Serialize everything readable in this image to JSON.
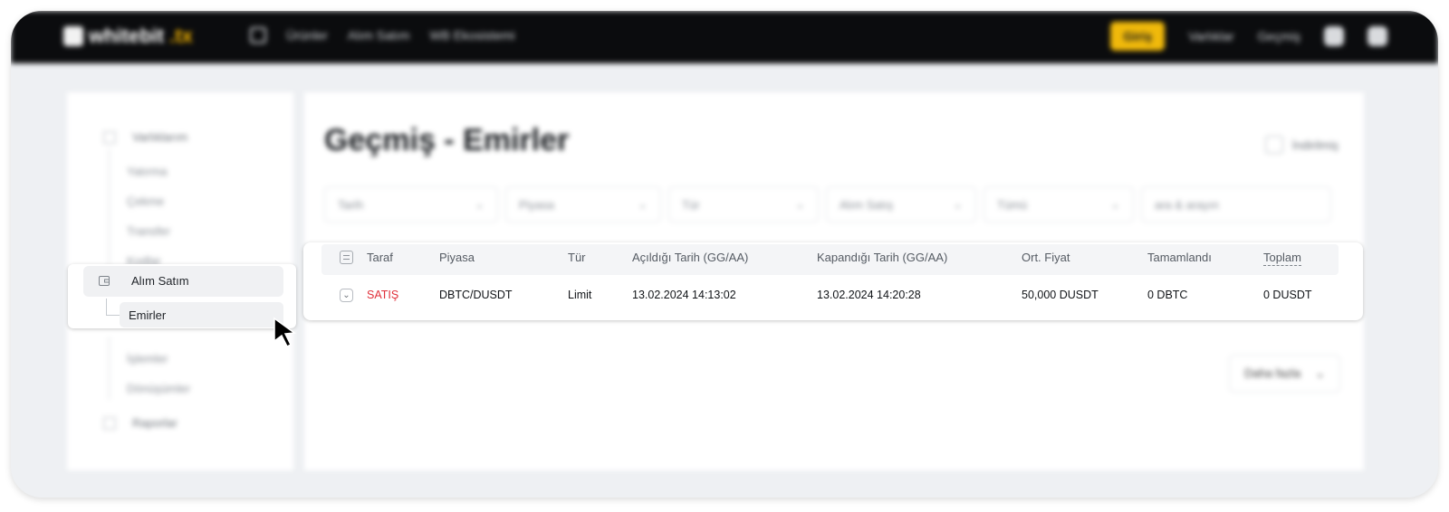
{
  "topbar": {
    "logo_text_a": "whitebit",
    "logo_text_b": ".tx",
    "nav": [
      "Ürünler",
      "Alım Satım",
      "WB Ekosistemi"
    ],
    "cta": "Giriş",
    "links": [
      "Varlıklar",
      "Geçmiş"
    ]
  },
  "sidebar": {
    "group1_label": "Varlıklarım",
    "group1_items": [
      "Yatırma",
      "Çekme",
      "Transfer",
      "Kodlar"
    ],
    "trade_label": "Alım Satım",
    "trade_items": [
      "Emirler",
      "İşlemler",
      "Dönüşümler"
    ],
    "group3_label": "Raporlar"
  },
  "main": {
    "title": "Geçmiş - Emirler",
    "download_label": "İndirilmiş",
    "filters": [
      {
        "label": "Tarih"
      },
      {
        "label": "Piyasa"
      },
      {
        "label": "Tür"
      },
      {
        "label": "Alım Satış"
      },
      {
        "label": "Tümü"
      },
      {
        "label": "ara & arayın"
      }
    ],
    "pager_label": "Daha fazla"
  },
  "table": {
    "headers": [
      "Taraf",
      "Piyasa",
      "Tür",
      "Açıldığı Tarih (GG/AA)",
      "Kapandığı Tarih (GG/AA)",
      "Ort. Fiyat",
      "Tamamlandı",
      "Toplam"
    ],
    "rows": [
      {
        "side": "SATIŞ",
        "market": "DBTC/DUSDT",
        "type": "Limit",
        "opened": "13.02.2024 14:13:02",
        "closed": "13.02.2024 14:20:28",
        "avg_price": "50,000 DUSDT",
        "filled": "0 DBTC",
        "total": "0 DUSDT"
      }
    ]
  },
  "colors": {
    "sell": "#e0303a",
    "accent": "#f0b90b"
  }
}
